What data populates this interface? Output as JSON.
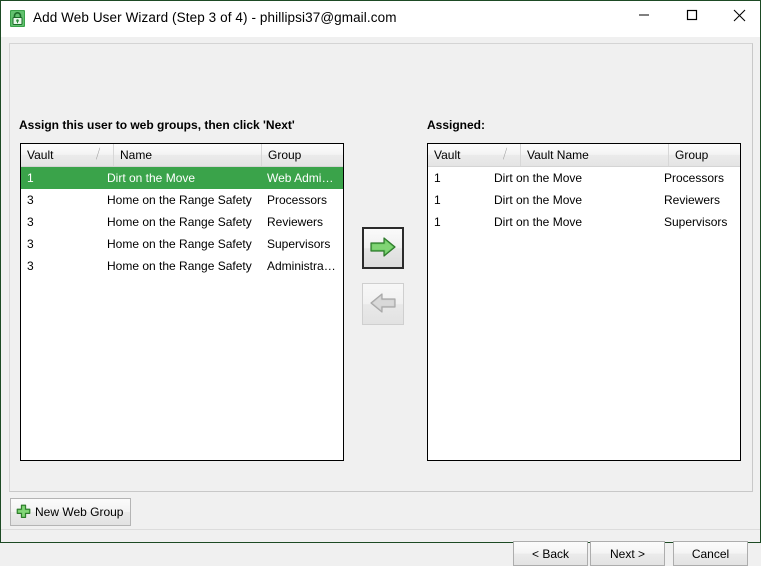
{
  "window": {
    "title": "Add Web User Wizard (Step 3 of 4) - phillipsi37@gmail.com",
    "icon": "vault-lock-icon",
    "controls": {
      "minimize": "minimize-icon",
      "maximize": "maximize-icon",
      "close": "close-icon"
    },
    "accent_green": "#3aa34a",
    "border_color": "#1d4a24"
  },
  "left_panel": {
    "label": "Assign this user to web groups, then click 'Next'",
    "columns": [
      "Vault",
      "Name",
      "Group"
    ],
    "sort_indicator": "ascending",
    "sorted_column": "Vault",
    "rows": [
      {
        "vault": "1",
        "name": "Dirt on the Move",
        "group": "Web Admini...",
        "selected": true
      },
      {
        "vault": "3",
        "name": "Home on the Range Safety",
        "group": "Processors",
        "selected": false
      },
      {
        "vault": "3",
        "name": "Home on the Range Safety",
        "group": "Reviewers",
        "selected": false
      },
      {
        "vault": "3",
        "name": "Home on the Range Safety",
        "group": "Supervisors",
        "selected": false
      },
      {
        "vault": "3",
        "name": "Home on the Range Safety",
        "group": "Administrators",
        "selected": false
      }
    ]
  },
  "right_panel": {
    "label": "Assigned:",
    "columns": [
      "Vault",
      "Vault Name",
      "Group"
    ],
    "sort_indicator": "ascending",
    "sorted_column": "Vault",
    "rows": [
      {
        "vault": "1",
        "vault_name": "Dirt on the Move",
        "group": "Processors"
      },
      {
        "vault": "1",
        "vault_name": "Dirt on the Move",
        "group": "Reviewers"
      },
      {
        "vault": "1",
        "vault_name": "Dirt on the Move",
        "group": "Supervisors"
      }
    ]
  },
  "transfer": {
    "add_button": {
      "icon": "arrow-right-icon",
      "enabled": true
    },
    "remove_button": {
      "icon": "arrow-left-icon",
      "enabled": false
    }
  },
  "toolbar": {
    "new_web_group_label": "New Web Group",
    "new_web_group_icon": "plus-icon"
  },
  "footer": {
    "back_label": "< Back",
    "next_label": "Next >",
    "cancel_label": "Cancel"
  }
}
